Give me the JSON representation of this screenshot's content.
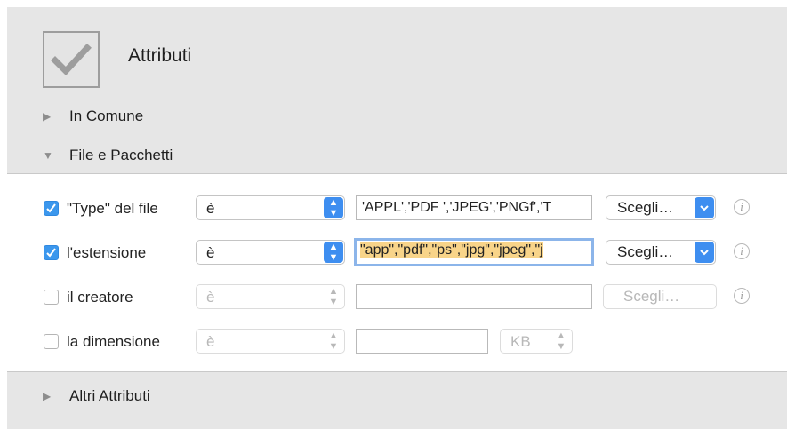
{
  "header": {
    "title": "Attributi",
    "icon": "checkbox-icon"
  },
  "sections": {
    "common": {
      "label": "In Comune",
      "expanded": false
    },
    "files": {
      "label": "File e Pacchetti",
      "expanded": true
    },
    "other": {
      "label": "Altri Attributi",
      "expanded": false
    }
  },
  "rows": [
    {
      "checked": true,
      "label": "\"Type\" del file",
      "operator": "è",
      "value": "'APPL','PDF ','JPEG','PNGf','T",
      "choose": "Scegli…",
      "enabled": true
    },
    {
      "checked": true,
      "label": "l'estensione",
      "operator": "è",
      "value": "\"app\",\"pdf\",\"ps\",\"jpg\",\"jpeg\",\"j",
      "choose": "Scegli…",
      "enabled": true
    },
    {
      "checked": false,
      "label": "il creatore",
      "operator": "è",
      "value": "",
      "choose": "Scegli…",
      "enabled": false
    },
    {
      "checked": false,
      "label": "la dimensione",
      "operator": "è",
      "value": "",
      "unit": "KB",
      "enabled": false
    }
  ],
  "info_glyph": "i",
  "colors": {
    "accent": "#3b97ed",
    "selection": "#f8d489",
    "panel": "#e6e6e6"
  }
}
